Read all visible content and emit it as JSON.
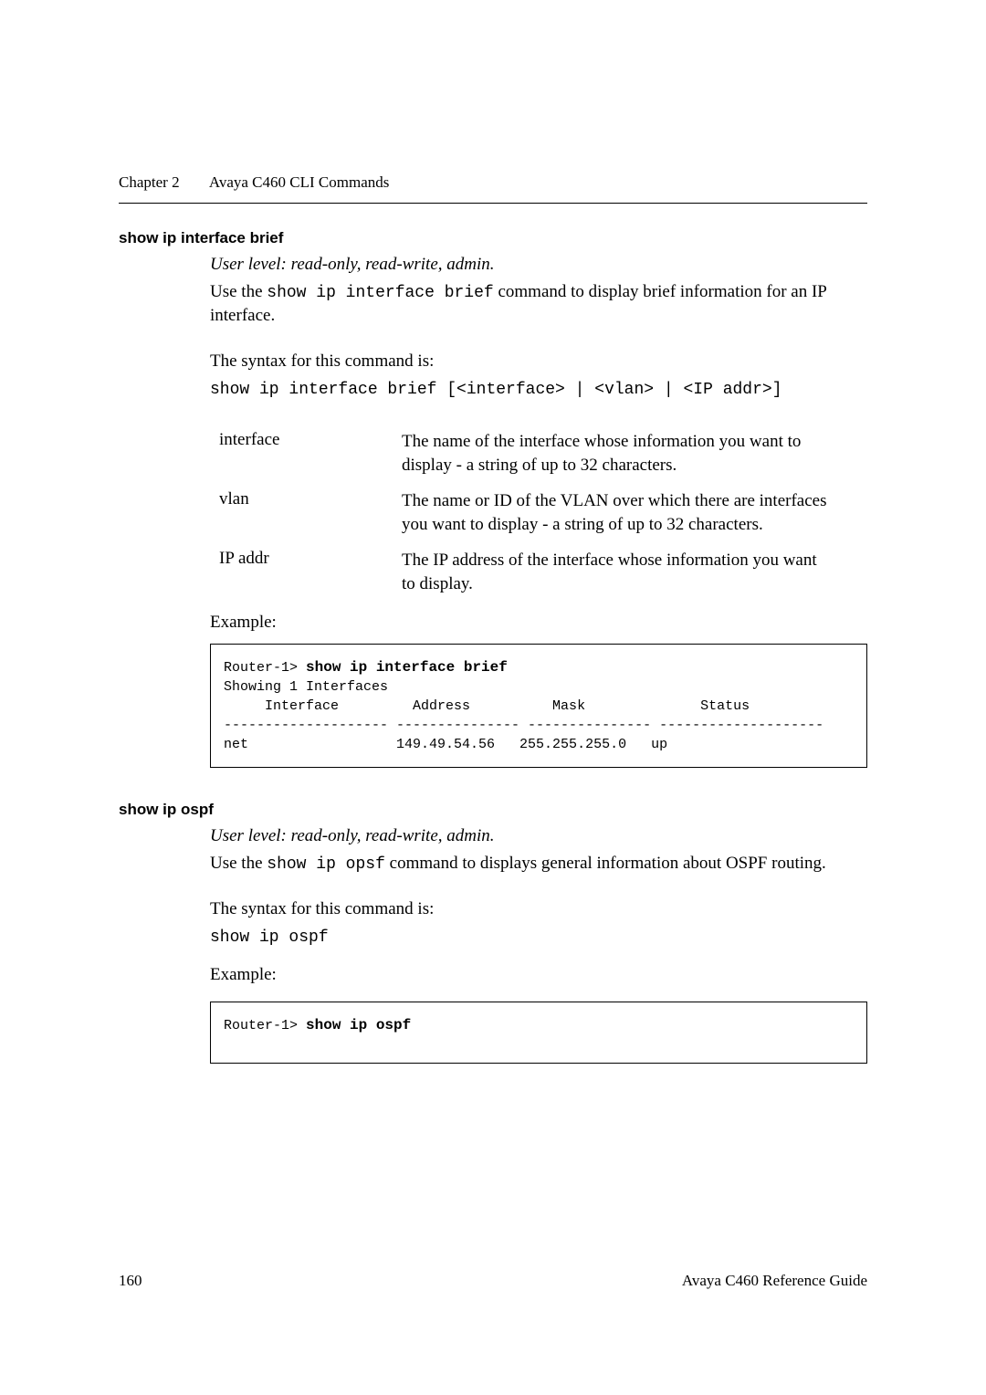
{
  "header": {
    "chapter": "Chapter 2",
    "title": "Avaya C460 CLI Commands"
  },
  "section1": {
    "heading": "show ip interface brief",
    "user_level": "User level: read-only, read-write, admin.",
    "intro_prefix": "Use the ",
    "intro_cmd": "show ip interface brief",
    "intro_suffix": " command to display brief information for an IP interface.",
    "syntax_label": "The syntax for this command is:",
    "syntax_cmd": "show ip interface brief [<interface> | <vlan> | <IP addr>]",
    "params": [
      {
        "name": "interface",
        "desc": "The name of the interface whose information you want to display - a string of up to 32 characters."
      },
      {
        "name": "vlan",
        "desc": "The name or ID of the VLAN over which there are interfaces you want to display - a string of up to 32 characters."
      },
      {
        "name": "IP addr",
        "desc": "The IP address of the interface whose information you want to display."
      }
    ],
    "example_label": "Example:",
    "example_prompt": "Router-1> ",
    "example_cmd": "show ip interface brief",
    "example_output": "Showing 1 Interfaces\n     Interface         Address          Mask              Status\n-------------------- --------------- --------------- --------------------\nnet                  149.49.54.56   255.255.255.0   up"
  },
  "section2": {
    "heading": "show ip ospf",
    "user_level": "User level: read-only, read-write, admin.",
    "intro_prefix": "Use the ",
    "intro_cmd": "show ip opsf",
    "intro_suffix": " command to displays general information about OSPF routing.",
    "syntax_label": "The syntax for this command is:",
    "syntax_cmd": "show ip ospf",
    "example_label": "Example:",
    "example_prompt": "Router-1> ",
    "example_cmd": "show ip ospf"
  },
  "footer": {
    "page": "160",
    "doc": "Avaya C460 Reference Guide"
  }
}
